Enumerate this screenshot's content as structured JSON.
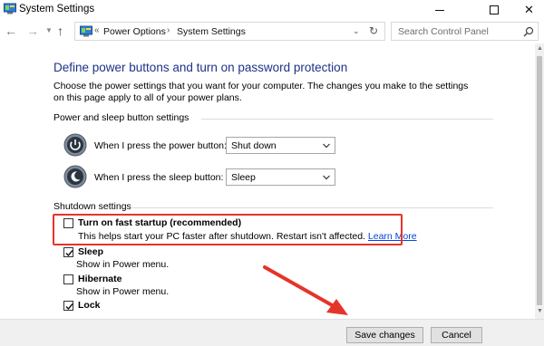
{
  "window": {
    "title": "System Settings",
    "icon": "control-panel-icon",
    "controls": {
      "minimize": "minimize-icon",
      "maximize": "maximize-icon",
      "close": "✕"
    }
  },
  "navigation": {
    "back": "←",
    "forward": "→",
    "up": "↑",
    "overflow": "«",
    "breadcrumbs": [
      "Power Options",
      "System Settings"
    ],
    "separator": "›",
    "search_placeholder": "Search Control Panel"
  },
  "main": {
    "heading": "Define power buttons and turn on password protection",
    "description": "Choose the power settings that you want for your computer. The changes you make to the settings on this page apply to all of your power plans.",
    "power_group": {
      "label": "Power and sleep button settings",
      "rows": [
        {
          "label": "When I press the power button:",
          "value": "Shut down",
          "icon": "power-button-icon"
        },
        {
          "label": "When I press the sleep button:",
          "value": "Sleep",
          "icon": "sleep-button-icon"
        }
      ]
    },
    "shutdown_group": {
      "label": "Shutdown settings",
      "options": [
        {
          "title": "Turn on fast startup (recommended)",
          "description": "This helps start your PC faster after shutdown. Restart isn't affected.",
          "link": "Learn More",
          "checked": false
        },
        {
          "title": "Sleep",
          "description": "Show in Power menu.",
          "checked": true
        },
        {
          "title": "Hibernate",
          "description": "Show in Power menu.",
          "checked": false
        },
        {
          "title": "Lock",
          "description": "",
          "checked": true
        }
      ]
    }
  },
  "footer": {
    "save_label": "Save changes",
    "cancel_label": "Cancel"
  },
  "colors": {
    "heading": "#1e3287",
    "link": "#0645d6",
    "annotation": "#e5342a"
  }
}
